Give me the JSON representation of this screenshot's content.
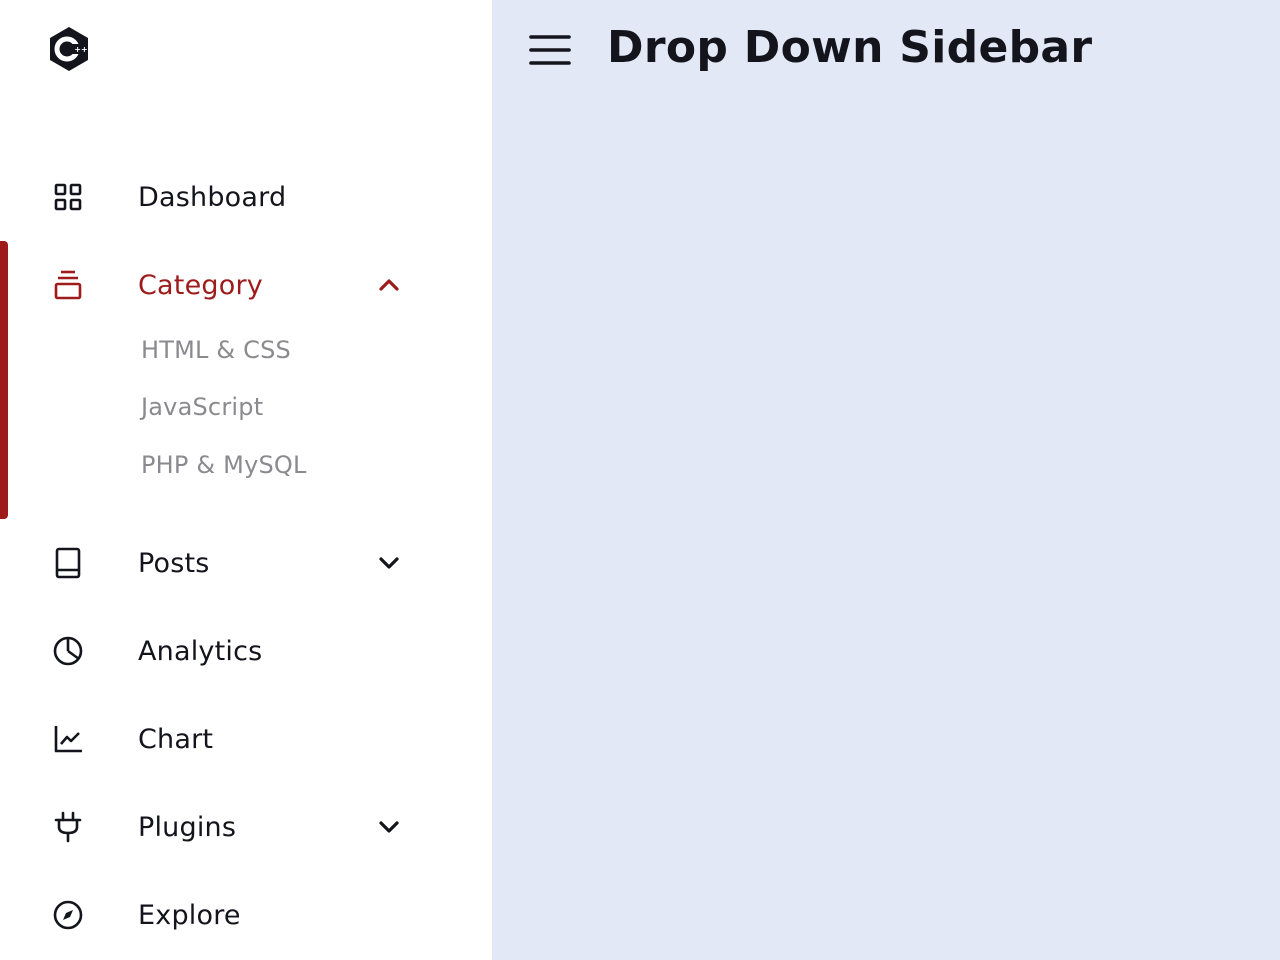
{
  "header": {
    "title": "Drop Down Sidebar"
  },
  "sidebar": {
    "logo_text": "C++",
    "active_color": "#9e1b1b",
    "items": [
      {
        "label": "Dashboard",
        "icon": "grid-icon",
        "has_submenu": false
      },
      {
        "label": "Category",
        "icon": "layers-icon",
        "has_submenu": true,
        "expanded": true,
        "active": true,
        "submenu": [
          "HTML & CSS",
          "JavaScript",
          "PHP & MySQL"
        ]
      },
      {
        "label": "Posts",
        "icon": "book-icon",
        "has_submenu": true,
        "expanded": false
      },
      {
        "label": "Analytics",
        "icon": "pie-chart-icon",
        "has_submenu": false
      },
      {
        "label": "Chart",
        "icon": "line-chart-icon",
        "has_submenu": false
      },
      {
        "label": "Plugins",
        "icon": "plug-icon",
        "has_submenu": true,
        "expanded": false
      },
      {
        "label": "Explore",
        "icon": "compass-icon",
        "has_submenu": false
      }
    ]
  }
}
